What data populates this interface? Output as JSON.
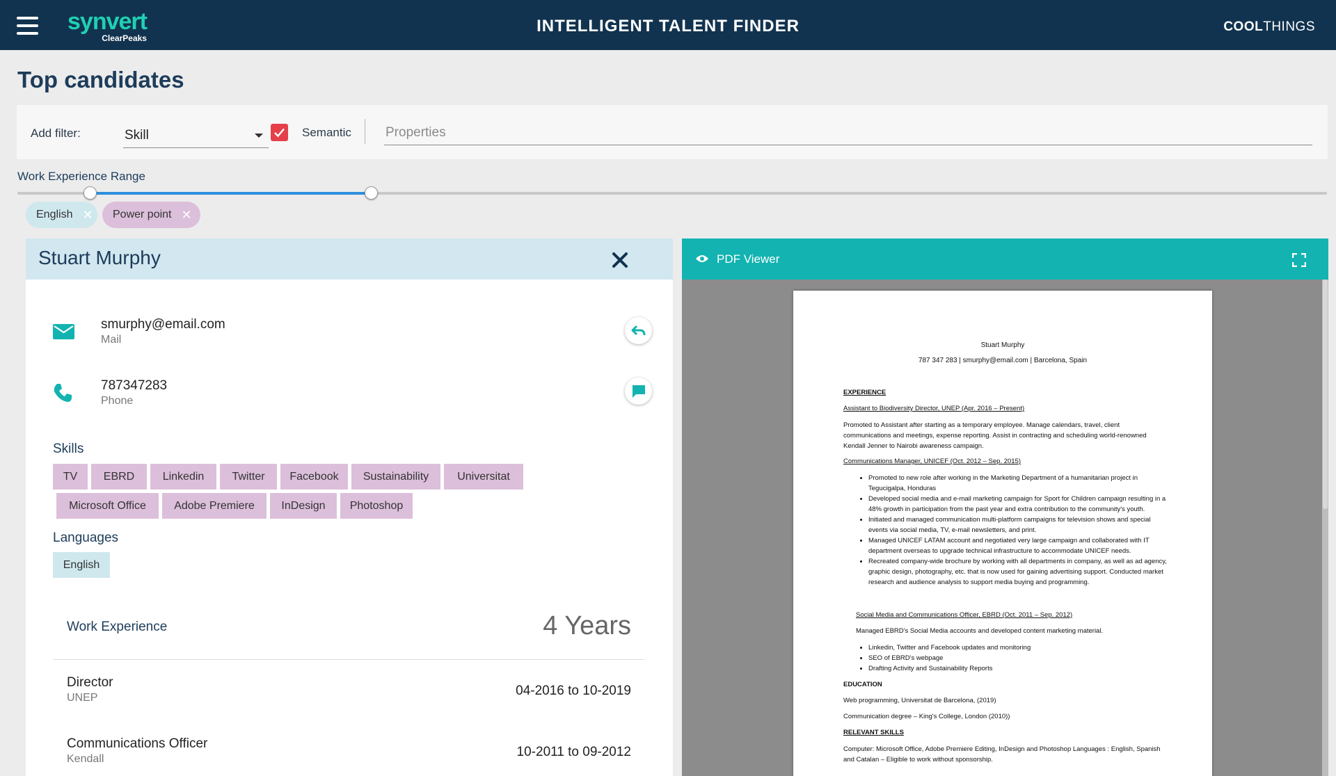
{
  "header": {
    "logo_main": "synvert",
    "logo_sub": "ClearPeaks",
    "app_title": "INTELLIGENT TALENT FINDER",
    "brand_bold": "COOL",
    "brand_rest": "THINGS"
  },
  "page_title": "Top candidates",
  "filter": {
    "label": "Add filter:",
    "selected": "Skill",
    "semantic_checked": true,
    "semantic_label": "Semantic",
    "properties_placeholder": "Properties"
  },
  "range": {
    "label": "Work Experience Range",
    "low_fraction": 0.055,
    "high_fraction": 0.27
  },
  "chips": [
    "English",
    "Power point"
  ],
  "candidate": {
    "name": "Stuart Murphy",
    "email": "smurphy@email.com",
    "email_label": "Mail",
    "phone": "787347283",
    "phone_label": "Phone",
    "skills_title": "Skills",
    "skills": [
      "TV",
      "EBRD",
      "Linkedin",
      "Twitter",
      "Facebook",
      "Sustainability",
      "Universitat",
      "Microsoft Office",
      "Adobe Premiere",
      "InDesign",
      "Photoshop"
    ],
    "languages_title": "Languages",
    "languages": [
      "English"
    ],
    "work_experience_label": "Work Experience",
    "work_experience_years": "4 Years",
    "jobs": [
      {
        "title": "Director",
        "org": "UNEP",
        "dates": "04-2016 to 10-2019"
      },
      {
        "title": "Communications Officer",
        "org": "Kendall",
        "dates": "10-2011 to 09-2012"
      }
    ]
  },
  "pdf": {
    "title": "PDF Viewer",
    "doc": {
      "name": "Stuart Murphy",
      "contact": "787 347 283 | smurphy@email.com | Barcelona, Spain",
      "experience_heading": "EXPERIENCE",
      "job1_title": "Assistant to Biodiversity Director, UNEP (Apr. 2016 – Present)",
      "job1_text": "Promoted to Assistant after starting as a temporary employee. Manage calendars, travel, client communications and meetings, expense reporting. Assist in contracting and scheduling world-renowned Kendall Jenner to Nairobi awareness campaign.",
      "job2_title": "Communications Manager, UNICEF (Oct. 2012 – Sep. 2015)",
      "job2_bullets": [
        "Promoted to new role after working in the Marketing Department of a humanitarian project in Tegucigalpa, Honduras",
        "Developed social media and e-mail marketing campaign for Sport for Children campaign resulting in a 48% growth in participation from the past year and extra contribution to the community's youth.",
        "Initiated and managed communication multi-platform campaigns for television shows and special events via social media, TV, e-mail newsletters, and print.",
        "Managed UNICEF LATAM account and negotiated very large campaign and collaborated with IT department overseas to upgrade technical infrastructure to accommodate UNICEF needs.",
        "Recreated company-wide brochure by working with all departments in company, as well as ad agency, graphic design, photography, etc. that is now used for gaining advertising support. Conducted market research and audience analysis to support media buying and programming."
      ],
      "job3_title": "Social Media and Communications Officer, EBRD (Oct. 2011 – Sep. 2012)",
      "job3_text": "Managed EBRD's Social Media accounts and developed content marketing material.",
      "job3_bullets": [
        "Linkedin, Twitter and Facebook updates and monitoring",
        "SEO of EBRD's webpage",
        "Drafting Activity and Sustainability Reports"
      ],
      "education_heading": "EDUCATION",
      "edu1": "Web programming, Universitat de Barcelona, (2019)",
      "edu2": "Communication degree – King's College, London (2010))",
      "skills_heading": "RELEVANT SKILLS",
      "skills_text": "Computer: Microsoft Office, Adobe Premiere Editing, InDesign and Photoshop Languages : English, Spanish and Catalan – Eligible to work without sponsorship."
    }
  },
  "colors": {
    "header_bg": "#12334f",
    "logo": "#1fd1b3",
    "pdf_header": "#12b3b1",
    "skill_tag": "#dcbfdb",
    "lang_tag": "#cfe8ee",
    "checkbox": "#e5404a",
    "slider": "#2e8fdc"
  },
  "icons": [
    "menu-icon",
    "mail-icon",
    "phone-icon",
    "reply-icon",
    "chat-icon",
    "close-icon",
    "eye-icon",
    "fullscreen-icon",
    "check-icon"
  ]
}
